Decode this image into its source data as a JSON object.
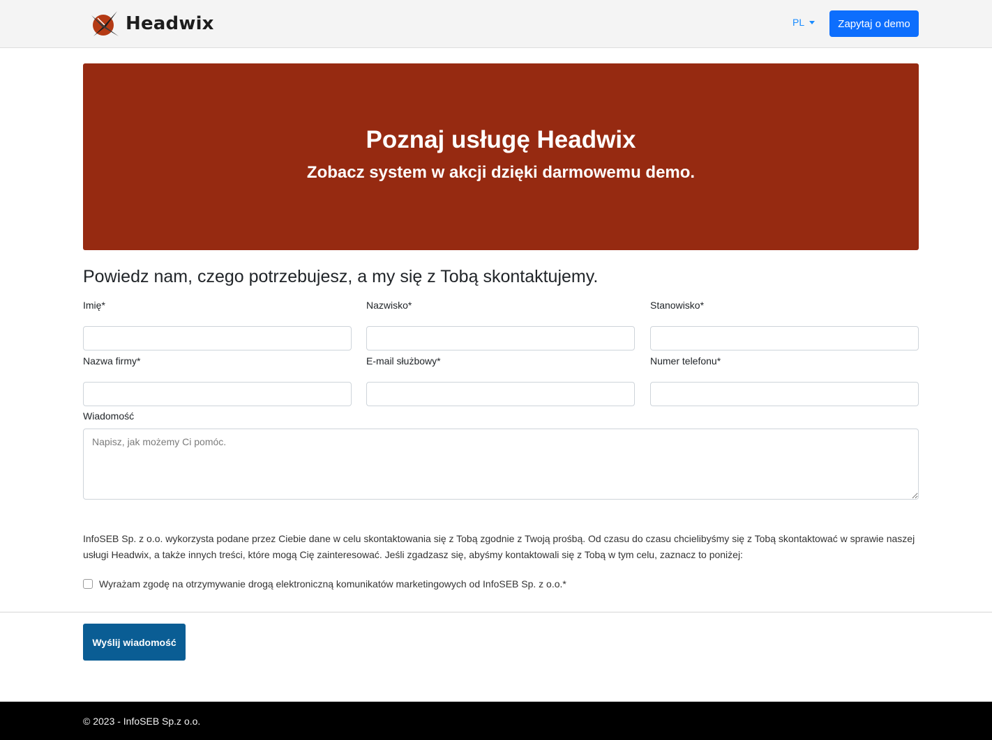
{
  "colors": {
    "accent": "#0d6efd",
    "hero_background": "#962a11",
    "send_button": "#0a5d94",
    "footer_background": "#000000",
    "navbar_background": "#f4f4f4"
  },
  "navbar": {
    "brand_name": "Headwix",
    "logo_icon": "headwix-x-logo-icon",
    "language": "PL",
    "demo_button": "Zapytaj o demo"
  },
  "hero": {
    "title": "Poznaj usługę Headwix",
    "subtitle": "Zobacz system w akcji dzięki darmowemu demo."
  },
  "form": {
    "heading": "Powiedz nam, czego potrzebujesz, a my się z Tobą skontaktujemy.",
    "fields": [
      {
        "label": "Imię*",
        "value": ""
      },
      {
        "label": "Nazwisko*",
        "value": ""
      },
      {
        "label": "Stanowisko*",
        "value": ""
      },
      {
        "label": "Nazwa firmy*",
        "value": ""
      },
      {
        "label": "E-mail służbowy*",
        "value": ""
      },
      {
        "label": "Numer telefonu*",
        "value": ""
      }
    ],
    "message_label": "Wiadomość",
    "message_placeholder": "Napisz, jak możemy Ci pomóc.",
    "consent_info": "InfoSEB Sp. z o.o. wykorzysta podane przez Ciebie dane w celu skontaktowania się z Tobą zgodnie z Twoją prośbą. Od czasu do czasu chcielibyśmy się z Tobą skontaktować w sprawie naszej usługi Headwix, a także innych treści, które mogą Cię zainteresować. Jeśli zgadzasz się, abyśmy kontaktowali się z Tobą w tym celu, zaznacz to poniżej:",
    "consent_checkbox_label": "Wyrażam zgodę na otrzymywanie drogą elektroniczną komunikatów marketingowych od InfoSEB Sp. z o.o.*",
    "consent_checked": false,
    "submit_button": "Wyślij wiadomość"
  },
  "footer": {
    "copyright": "© 2023 - InfoSEB Sp.z o.o."
  }
}
